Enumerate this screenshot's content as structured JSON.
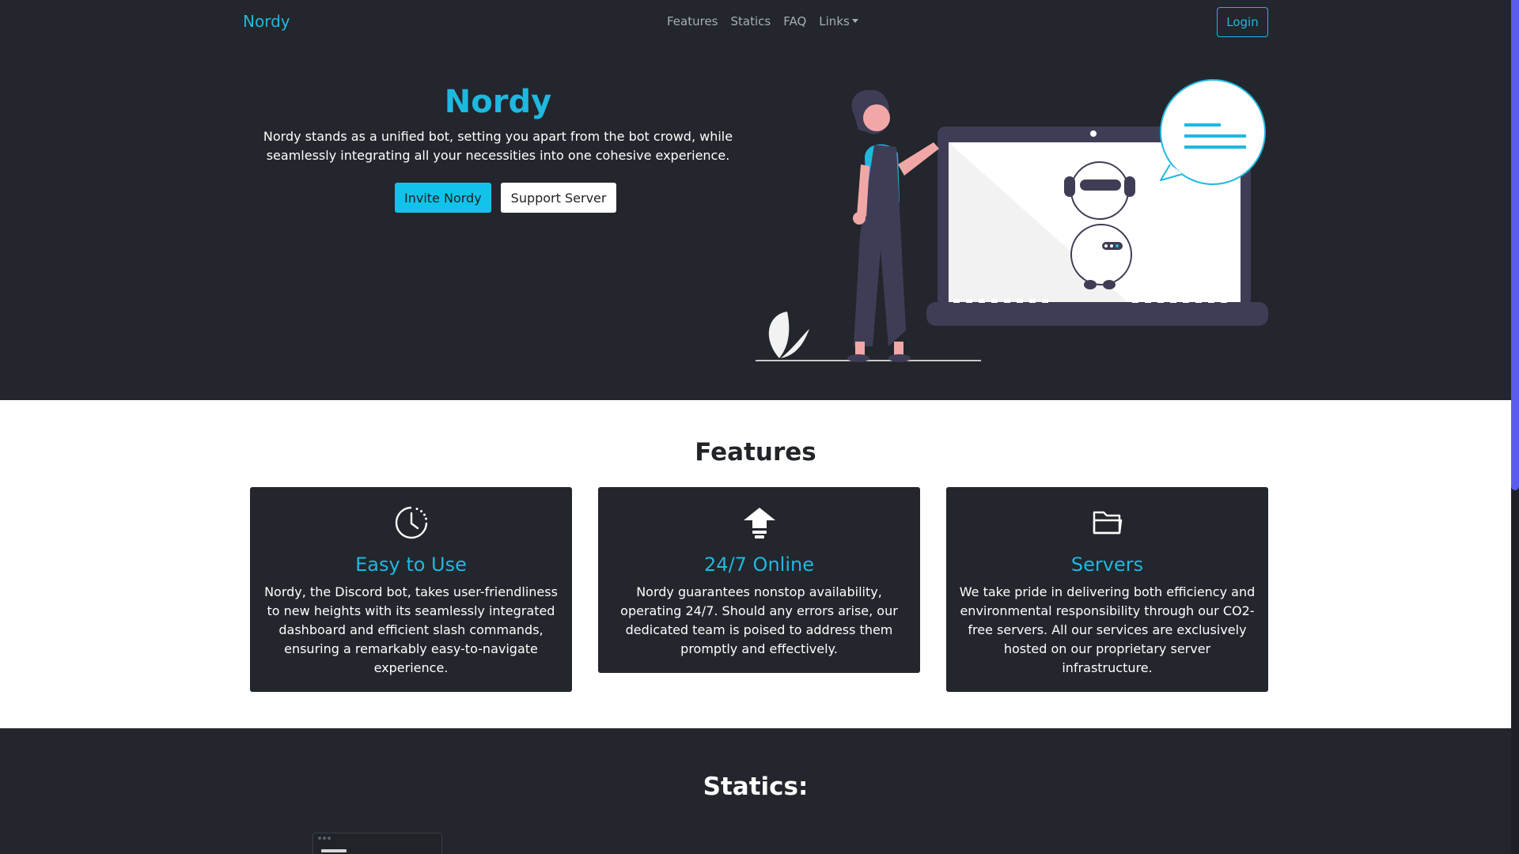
{
  "navbar": {
    "brand": "Nordy",
    "links": [
      "Features",
      "Statics",
      "FAQ"
    ],
    "dropdown_label": "Links",
    "login_label": "Login"
  },
  "hero": {
    "title": "Nordy",
    "description": "Nordy stands as a unified bot, setting you apart from the bot crowd, while seamlessly integrating all your necessities into one cohesive experience.",
    "invite_label": "Invite Nordy",
    "support_label": "Support Server",
    "illustration_icon": "woman-with-laptop-robot-illustration"
  },
  "features": {
    "heading": "Features",
    "cards": [
      {
        "icon": "clock-icon",
        "title": "Easy to Use",
        "text": "Nordy, the Discord bot, takes user-friendliness to new heights with its seamlessly integrated dashboard and efficient slash commands, ensuring a remarkably easy-to-navigate experience."
      },
      {
        "icon": "cloud-upload-icon",
        "title": "24/7 Online",
        "text": "Nordy guarantees nonstop availability, operating 24/7. Should any errors arise, our dedicated team is poised to address them promptly and effectively."
      },
      {
        "icon": "folder-icon",
        "title": "Servers",
        "text": "We take pride in delivering both efficiency and environmental responsibility through our CO2-free servers. All our services are exclusively hosted on our proprietary server infrastructure."
      }
    ]
  },
  "statics": {
    "heading": "Statics:"
  },
  "colors": {
    "accent": "#1fb8e0",
    "dark_bg": "#23262c",
    "light_bg": "#ffffff",
    "invite_button": "#11c3ea",
    "illustration_purple": "#3f3d56",
    "scrollbar": "#5a5cf0"
  }
}
